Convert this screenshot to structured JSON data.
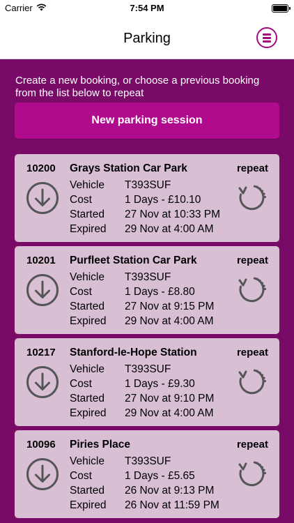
{
  "status_bar": {
    "carrier": "Carrier",
    "time": "7:54 PM"
  },
  "nav": {
    "title": "Parking",
    "menu_icon": "hamburger-circle-icon"
  },
  "intro": "Create a new booking, or choose a previous booking from the list below to repeat",
  "new_session_label": "New parking session",
  "labels": {
    "vehicle": "Vehicle",
    "cost": "Cost",
    "started": "Started",
    "expired": "Expired",
    "repeat": "repeat"
  },
  "colors": {
    "background": "#7a0a68",
    "accent": "#b10b8d",
    "card": "#d8bfd4",
    "icon": "#555555"
  },
  "bookings": [
    {
      "id": "10200",
      "name": "Grays Station Car Park",
      "vehicle": "T393SUF",
      "cost": "1 Days - £10.10",
      "started": "27 Nov at 10:33 PM",
      "expired": "29 Nov at 4:00 AM"
    },
    {
      "id": "10201",
      "name": "Purfleet Station Car Park",
      "vehicle": "T393SUF",
      "cost": "1 Days - £8.80",
      "started": "27 Nov at 9:15 PM",
      "expired": "29 Nov at 4:00 AM"
    },
    {
      "id": "10217",
      "name": "Stanford-le-Hope Station",
      "vehicle": "T393SUF",
      "cost": "1 Days - £9.30",
      "started": "27 Nov at 9:10 PM",
      "expired": "29 Nov at 4:00 AM"
    },
    {
      "id": "10096",
      "name": "Piries Place",
      "vehicle": "T393SUF",
      "cost": "1 Days - £5.65",
      "started": "26 Nov at 9:13 PM",
      "expired": "26 Nov at 11:59 PM"
    }
  ]
}
